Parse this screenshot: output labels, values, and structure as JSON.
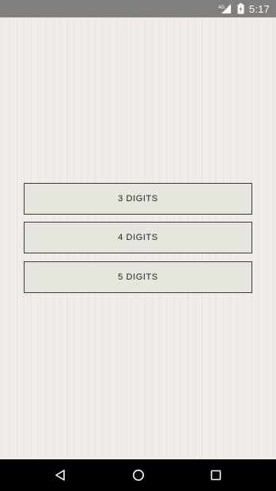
{
  "status_bar": {
    "network_label": "4G",
    "time": "5:17",
    "icons": [
      "signal-icon",
      "battery-icon"
    ]
  },
  "buttons": [
    {
      "label": "3 DIGITS"
    },
    {
      "label": "4 DIGITS"
    },
    {
      "label": "5 DIGITS"
    }
  ],
  "navigation": {
    "icons": [
      "back-icon",
      "home-icon",
      "recents-icon"
    ]
  },
  "colors": {
    "status_bar": "#7f7f7f",
    "background": "#f0ece7",
    "button_fill": "#e6e6df",
    "button_border": "#3a3a3a",
    "nav_bar": "#000000"
  }
}
